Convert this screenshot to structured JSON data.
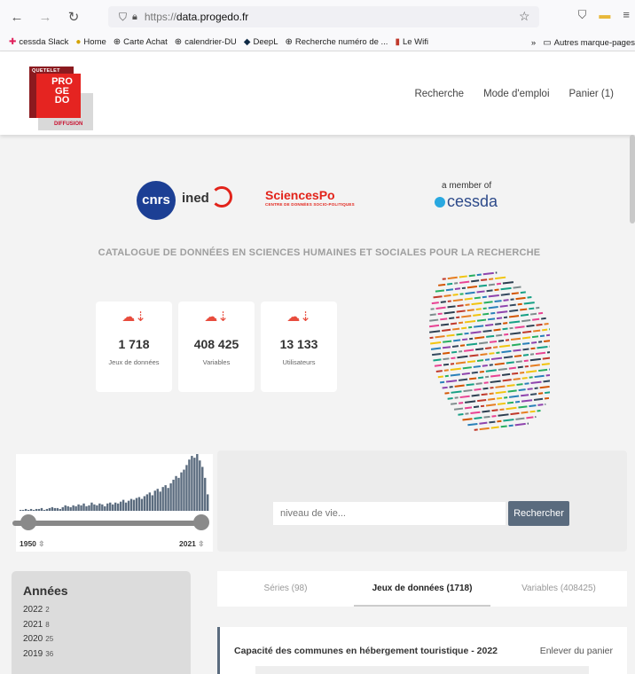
{
  "browser": {
    "url_protocol": "https://",
    "url_host": "data.progedo.fr",
    "bookmarks": [
      "cessda Slack",
      "Home",
      "Carte Achat",
      "calendrier-DU",
      "DeepL",
      "Recherche numéro de ...",
      "Le Wifi"
    ],
    "bookmarks_more": "»",
    "other_bookmarks": "Autres marque-pages"
  },
  "logo": {
    "top": "QUETELET",
    "main": "PRO GE DO",
    "bottom": "DIFFUSION"
  },
  "nav": {
    "search": "Recherche",
    "manual": "Mode d'emploi",
    "cart": "Panier (1)"
  },
  "partners": {
    "cnrs": "cnrs",
    "ined": "ined",
    "sciencespo": "SciencesPo",
    "sciencespo_sub": "CENTRE DE DONNÉES SOCIO-POLITIQUES",
    "cessda_member": "a member of",
    "cessda": "cessda"
  },
  "catalogue_title": "CATALOGUE DE DONNÉES EN SCIENCES HUMAINES ET SOCIALES POUR LA RECHERCHE",
  "stats": [
    {
      "value": "1 718",
      "label": "Jeux de données"
    },
    {
      "value": "408 425",
      "label": "Variables"
    },
    {
      "value": "13 133",
      "label": "Utilisateurs"
    }
  ],
  "histogram": {
    "from": "1950",
    "to": "2021",
    "values": [
      1,
      1,
      2,
      1,
      2,
      1,
      2,
      2,
      3,
      1,
      2,
      3,
      4,
      3,
      3,
      2,
      4,
      6,
      5,
      4,
      6,
      5,
      7,
      6,
      8,
      5,
      6,
      9,
      7,
      6,
      8,
      7,
      5,
      8,
      9,
      7,
      9,
      8,
      10,
      12,
      9,
      11,
      13,
      12,
      14,
      15,
      13,
      16,
      18,
      20,
      17,
      22,
      24,
      21,
      26,
      28,
      25,
      30,
      34,
      38,
      36,
      42,
      45,
      50,
      56,
      60,
      58,
      62,
      55,
      48,
      36,
      18
    ]
  },
  "search": {
    "placeholder": "niveau de vie...",
    "button": "Rechercher"
  },
  "years": {
    "title": "Années",
    "items": [
      {
        "year": "2022",
        "count": "2"
      },
      {
        "year": "2021",
        "count": "8"
      },
      {
        "year": "2020",
        "count": "25"
      },
      {
        "year": "2019",
        "count": "36"
      }
    ]
  },
  "tabs": [
    {
      "label": "Séries (98)"
    },
    {
      "label": "Jeux de données (1718)"
    },
    {
      "label": "Variables (408425)"
    }
  ],
  "result": {
    "title": "Capacité des communes en hébergement touristique - 2022",
    "action": "Enlever du panier"
  },
  "colors": {
    "accent": "#5a6b7e",
    "brand_red": "#e52421",
    "icon_red": "#e84c3d"
  }
}
